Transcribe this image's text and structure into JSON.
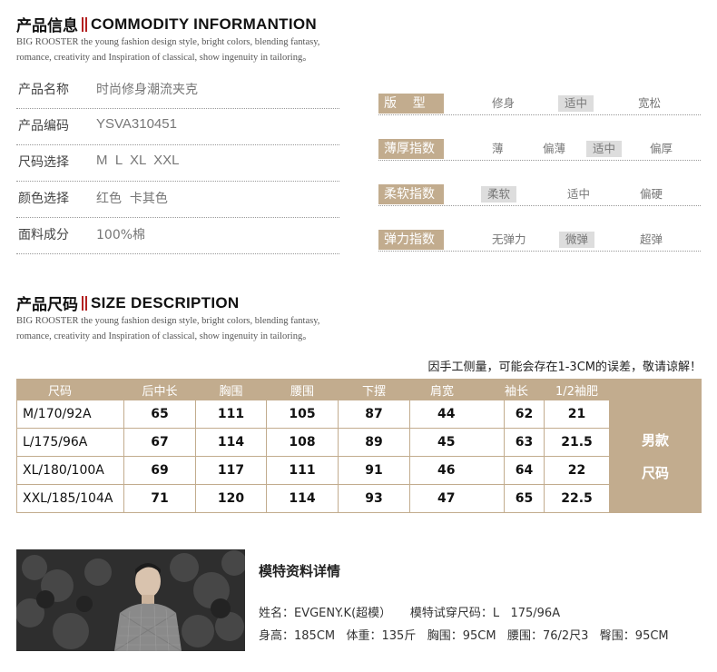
{
  "commodity": {
    "title_cn": "产品信息",
    "title_en": "COMMODITY INFORMANTION",
    "subtitle_1": "BIG ROOSTER the young fashion design style, bright colors, blending fantasy,",
    "subtitle_2": "romance, creativity and Inspiration of classical, show ingenuity in tailoring。",
    "rows": [
      {
        "label": "产品名称",
        "value": "时尚修身潮流夹克"
      },
      {
        "label": "产品编码",
        "value": "YSVA310451"
      },
      {
        "label": "尺码选择",
        "value": "M  L  XL  XXL"
      },
      {
        "label": "颜色选择",
        "value": "红色  卡其色"
      },
      {
        "label": "面料成分",
        "value": "100%棉"
      }
    ]
  },
  "indices": [
    {
      "label": "版    型",
      "options": [
        "修身",
        "适中",
        "宽松"
      ],
      "selected": 1
    },
    {
      "label": "薄厚指数",
      "options": [
        "薄",
        "偏薄",
        "适中",
        "偏厚"
      ],
      "selected": 2
    },
    {
      "label": "柔软指数",
      "options": [
        "柔软",
        "适中",
        "偏硬"
      ],
      "selected": 0
    },
    {
      "label": "弹力指数",
      "options": [
        "无弹力",
        "微弹",
        "超弹"
      ],
      "selected": 1
    }
  ],
  "size": {
    "title_cn": "产品尺码",
    "title_en": "SIZE DESCRIPTION",
    "subtitle_1": "BIG ROOSTER the young fashion design style, bright colors, blending fantasy,",
    "subtitle_2": "romance, creativity and Inspiration of classical, show ingenuity in tailoring。",
    "note": "因手工侧量，可能会存在1-3CM的误差，敬请谅解！",
    "headers": [
      "尺码",
      "后中长",
      "胸围",
      "腰围",
      "下摆",
      "肩宽",
      "袖长",
      "1/2袖肥"
    ],
    "rows": [
      [
        "M/170/92A",
        "65",
        "111",
        "105",
        "87",
        "44",
        "62",
        "21"
      ],
      [
        "L/175/96A",
        "67",
        "114",
        "108",
        "89",
        "45",
        "63",
        "21.5"
      ],
      [
        "XL/180/100A",
        "69",
        "117",
        "111",
        "91",
        "46",
        "64",
        "22"
      ],
      [
        "XXL/185/104A",
        "71",
        "120",
        "114",
        "93",
        "47",
        "65",
        "22.5"
      ]
    ],
    "side_line1": "男款",
    "side_line2": "尺码"
  },
  "model": {
    "title": "模特资料详情",
    "line1": "姓名：EVGENY.K(超模）     模特试穿尺码：L   175/96A",
    "line2": "身高：185CM   体重：135斤   胸围：95CM   腰围：76/2尺3   臀围：95CM"
  },
  "colors": {
    "accent": "#c2ac8e",
    "bar": "#b32020"
  }
}
